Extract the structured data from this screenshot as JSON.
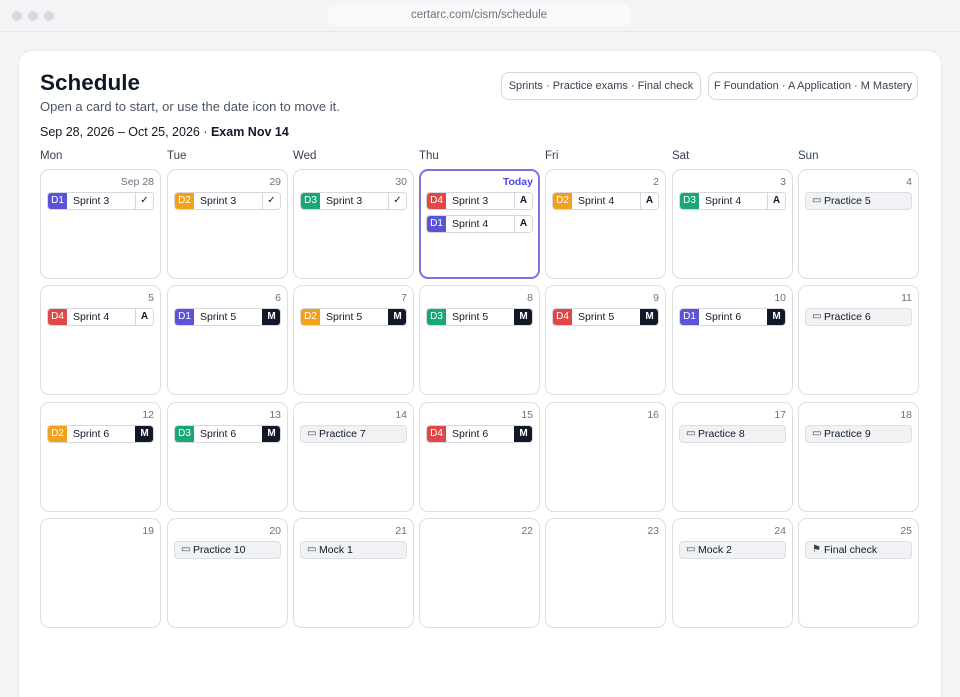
{
  "browser": {
    "url": "certarc.com/cism/schedule"
  },
  "header": {
    "title": "Schedule",
    "subtitle": "Open a card to start, or use the date icon to move it.",
    "range": "Sep 28, 2026 – Oct 25, 2026 · ",
    "exam": "Exam Nov 14",
    "legend_pill": "Sprints · Practice exams · Final check",
    "levels_pill": "F Foundation · A Application · M Mastery"
  },
  "weekdays": [
    "Mon",
    "Tue",
    "Wed",
    "Thu",
    "Fri",
    "Sat",
    "Sun"
  ],
  "icons": {
    "practice": "exam-sheet-icon",
    "final": "flag-icon",
    "check": "checkmark-icon"
  },
  "colors": {
    "D1": "#5b54d6",
    "D2": "#f2a11a",
    "D3": "#1aa774",
    "D4": "#e04848",
    "today_border": "#7c74d8",
    "mastery_badge": "#111827"
  },
  "calendar": [
    {
      "date": "Sep 28",
      "items": [
        {
          "kind": "sprint",
          "domain": "D1",
          "label": "Sprint 3",
          "level": "✓"
        }
      ]
    },
    {
      "date": "29",
      "items": [
        {
          "kind": "sprint",
          "domain": "D2",
          "label": "Sprint 3",
          "level": "✓"
        }
      ]
    },
    {
      "date": "30",
      "items": [
        {
          "kind": "sprint",
          "domain": "D3",
          "label": "Sprint 3",
          "level": "✓"
        }
      ]
    },
    {
      "date": "Today",
      "today": true,
      "items": [
        {
          "kind": "sprint",
          "domain": "D4",
          "label": "Sprint 3",
          "level": "A"
        },
        {
          "kind": "sprint",
          "domain": "D1",
          "label": "Sprint 4",
          "level": "A"
        }
      ]
    },
    {
      "date": "2",
      "items": [
        {
          "kind": "sprint",
          "domain": "D2",
          "label": "Sprint 4",
          "level": "A"
        }
      ]
    },
    {
      "date": "3",
      "items": [
        {
          "kind": "sprint",
          "domain": "D3",
          "label": "Sprint 4",
          "level": "A"
        }
      ]
    },
    {
      "date": "4",
      "items": [
        {
          "kind": "practice",
          "icon": "▭",
          "label": "Practice 5"
        }
      ]
    },
    {
      "date": "5",
      "items": [
        {
          "kind": "sprint",
          "domain": "D4",
          "label": "Sprint 4",
          "level": "A"
        }
      ]
    },
    {
      "date": "6",
      "items": [
        {
          "kind": "sprint",
          "domain": "D1",
          "label": "Sprint 5",
          "level": "M"
        }
      ]
    },
    {
      "date": "7",
      "items": [
        {
          "kind": "sprint",
          "domain": "D2",
          "label": "Sprint 5",
          "level": "M"
        }
      ]
    },
    {
      "date": "8",
      "items": [
        {
          "kind": "sprint",
          "domain": "D3",
          "label": "Sprint 5",
          "level": "M"
        }
      ]
    },
    {
      "date": "9",
      "items": [
        {
          "kind": "sprint",
          "domain": "D4",
          "label": "Sprint 5",
          "level": "M"
        }
      ]
    },
    {
      "date": "10",
      "items": [
        {
          "kind": "sprint",
          "domain": "D1",
          "label": "Sprint 6",
          "level": "M"
        }
      ]
    },
    {
      "date": "11",
      "items": [
        {
          "kind": "practice",
          "icon": "▭",
          "label": "Practice 6"
        }
      ]
    },
    {
      "date": "12",
      "items": [
        {
          "kind": "sprint",
          "domain": "D2",
          "label": "Sprint 6",
          "level": "M"
        }
      ]
    },
    {
      "date": "13",
      "items": [
        {
          "kind": "sprint",
          "domain": "D3",
          "label": "Sprint 6",
          "level": "M"
        }
      ]
    },
    {
      "date": "14",
      "items": [
        {
          "kind": "practice",
          "icon": "▭",
          "label": "Practice 7"
        }
      ]
    },
    {
      "date": "15",
      "items": [
        {
          "kind": "sprint",
          "domain": "D4",
          "label": "Sprint 6",
          "level": "M"
        }
      ]
    },
    {
      "date": "16",
      "items": []
    },
    {
      "date": "17",
      "items": [
        {
          "kind": "practice",
          "icon": "▭",
          "label": "Practice 8"
        }
      ]
    },
    {
      "date": "18",
      "items": [
        {
          "kind": "practice",
          "icon": "▭",
          "label": "Practice 9"
        }
      ]
    },
    {
      "date": "19",
      "items": []
    },
    {
      "date": "20",
      "items": [
        {
          "kind": "practice",
          "icon": "▭",
          "label": "Practice 10"
        }
      ]
    },
    {
      "date": "21",
      "items": [
        {
          "kind": "practice",
          "icon": "▭",
          "label": "Mock 1"
        }
      ]
    },
    {
      "date": "22",
      "items": []
    },
    {
      "date": "23",
      "items": []
    },
    {
      "date": "24",
      "items": [
        {
          "kind": "practice",
          "icon": "▭",
          "label": "Mock 2"
        }
      ]
    },
    {
      "date": "25",
      "items": [
        {
          "kind": "final",
          "icon": "⚑",
          "label": "Final check"
        }
      ]
    }
  ]
}
